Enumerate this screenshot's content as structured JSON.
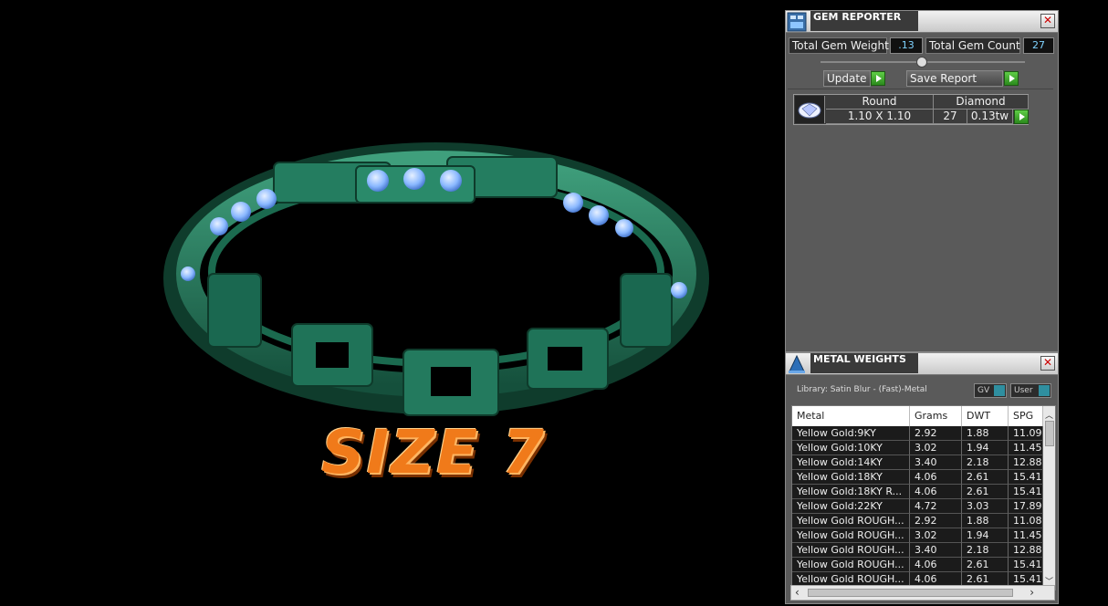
{
  "viewport": {
    "size_text": "SIZE 7",
    "colors": {
      "metal": "#1e6e54",
      "metal_light": "#3fae86",
      "gem": "#8ab8ff",
      "text_fill": "#f07a1a",
      "text_edge": "#ffd08a"
    }
  },
  "gem_reporter": {
    "title": "GEM REPORTER",
    "icon": "gem-reporter-icon",
    "close": "✕",
    "total_weight_label": "Total Gem Weight",
    "total_weight_value": ".13",
    "total_count_label": "Total Gem Count",
    "total_count_value": "27",
    "update_label": "Update",
    "save_label": "Save Report",
    "gem": {
      "icon": "diamond-thumbnail-icon",
      "shape": "Round",
      "type": "Diamond",
      "size": "1.10 X 1.10",
      "count": "27",
      "weight": "0.13tw"
    }
  },
  "metal_weights": {
    "title": "METAL WEIGHTS",
    "icon": "metal-weights-icon",
    "close": "✕",
    "library": "Library: Satin Blur - (Fast)-Metal",
    "gv_label": "GV",
    "user_label": "User",
    "columns": [
      "Metal",
      "Grams",
      "DWT",
      "SPG"
    ],
    "rows": [
      [
        "Yellow Gold:9KY",
        "2.92",
        "1.88",
        "11.09"
      ],
      [
        "Yellow Gold:10KY",
        "3.02",
        "1.94",
        "11.45"
      ],
      [
        "Yellow Gold:14KY",
        "3.40",
        "2.18",
        "12.88"
      ],
      [
        "Yellow Gold:18KY",
        "4.06",
        "2.61",
        "15.41"
      ],
      [
        "Yellow Gold:18KY R...",
        "4.06",
        "2.61",
        "15.41"
      ],
      [
        "Yellow Gold:22KY",
        "4.72",
        "3.03",
        "17.89"
      ],
      [
        "Yellow Gold ROUGH...",
        "2.92",
        "1.88",
        "11.08"
      ],
      [
        "Yellow Gold ROUGH...",
        "3.02",
        "1.94",
        "11.45"
      ],
      [
        "Yellow Gold ROUGH...",
        "3.40",
        "2.18",
        "12.88"
      ],
      [
        "Yellow Gold ROUGH...",
        "4.06",
        "2.61",
        "15.41"
      ],
      [
        "Yellow Gold ROUGH...",
        "4.06",
        "2.61",
        "15.41"
      ]
    ]
  }
}
